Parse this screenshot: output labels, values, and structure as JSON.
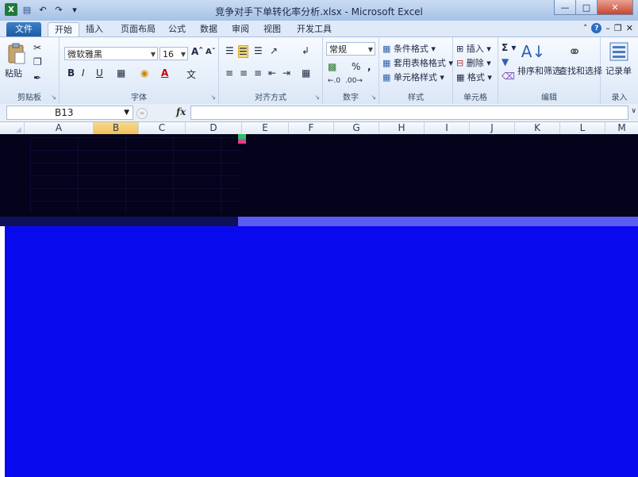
{
  "window": {
    "title": "竞争对手下单转化率分析.xlsx - Microsoft Excel"
  },
  "tabs": {
    "file": "文件",
    "home": "开始",
    "insert": "插入",
    "page_layout": "页面布局",
    "formulas": "公式",
    "data": "数据",
    "review": "审阅",
    "view": "视图",
    "developer": "开发工具"
  },
  "ribbon": {
    "clipboard": {
      "paste": "粘贴",
      "label": "剪贴板"
    },
    "font": {
      "name": "微软雅黑",
      "size": "16",
      "bold": "B",
      "italic": "I",
      "underline": "U",
      "label": "字体"
    },
    "alignment": {
      "label": "对齐方式"
    },
    "number": {
      "format": "常规",
      "percent": "%",
      "comma": ",",
      "label": "数字"
    },
    "styles": {
      "conditional": "条件格式",
      "table": "套用表格格式",
      "cell": "单元格样式",
      "label": "样式"
    },
    "cells": {
      "insert": "插入",
      "delete": "删除",
      "format": "格式",
      "label": "单元格"
    },
    "editing": {
      "sort": "排序和筛选",
      "find": "查找和选择",
      "label": "编辑"
    },
    "record": {
      "button": "记录单",
      "label": "录入"
    }
  },
  "formula_bar": {
    "name_box": "B13",
    "fx": "fx",
    "value": ""
  },
  "columns": [
    "A",
    "B",
    "C",
    "D",
    "E",
    "F",
    "G",
    "H",
    "I",
    "J",
    "K",
    "L",
    "M"
  ],
  "selected_column": "B",
  "colors": {
    "title_bar": "#b7cfee",
    "selected_header": "#f1c15a",
    "overlay_black": "#04031b",
    "overlay_blue": "#0909ee"
  }
}
